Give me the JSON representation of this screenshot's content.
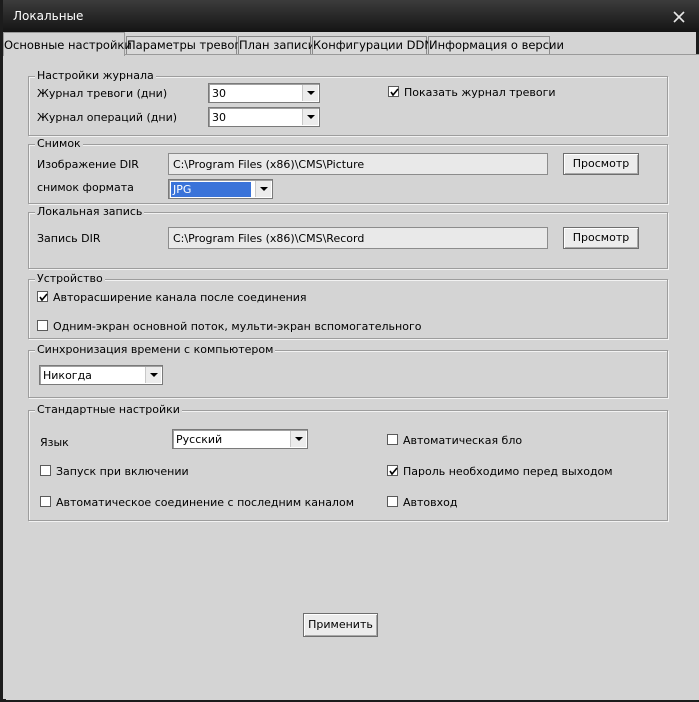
{
  "window": {
    "title": "Локальные",
    "close_icon": "close-icon"
  },
  "tabs": [
    {
      "label": "Основные настройки",
      "active": true
    },
    {
      "label": "Параметры тревоги",
      "active": false
    },
    {
      "label": "План записи",
      "active": false
    },
    {
      "label": "Конфигурации DDNS",
      "active": false
    },
    {
      "label": "Информация о версии",
      "active": false
    }
  ],
  "log_settings": {
    "legend": "Настройки журнала",
    "alarm_log_label": "Журнал тревоги (дни)",
    "alarm_log_value": "30",
    "ops_log_label": "Журнал операций (дни)",
    "ops_log_value": "30",
    "show_alarm_log_label": "Показать журнал тревоги",
    "show_alarm_log_checked": true
  },
  "snapshot": {
    "legend": "Снимок",
    "dir_label": "Изображение DIR",
    "dir_value": "C:\\Program Files (x86)\\CMS\\Picture",
    "browse_label": "Просмотр",
    "format_label": "снимок формата",
    "format_value": "JPG"
  },
  "local_record": {
    "legend": "Локальная запись",
    "dir_label": "Запись DIR",
    "dir_value": "C:\\Program Files (x86)\\CMS\\Record",
    "browse_label": "Просмотр"
  },
  "device": {
    "legend": "Устройство",
    "auto_expand_label": "Авторасширение канала после соединения",
    "auto_expand_checked": true,
    "single_screen_label": "Одним-экран основной поток, мульти-экран вспомогательного",
    "single_screen_checked": false
  },
  "time_sync": {
    "legend": "Синхронизация времени с компьютером",
    "value": "Никогда"
  },
  "standard": {
    "legend": "Стандартные настройки",
    "language_label": "Язык",
    "language_value": "Русский",
    "auto_lock_label": "Автоматическая блоки",
    "auto_lock_checked": false,
    "startup_label": "Запуск при включении",
    "startup_checked": false,
    "password_exit_label": "Пароль необходимо перед выходом",
    "password_exit_checked": true,
    "auto_connect_label": "Автоматическое соединение с последним каналом",
    "auto_connect_checked": false,
    "auto_login_label": "Автовход",
    "auto_login_checked": false
  },
  "apply_label": "Применить"
}
